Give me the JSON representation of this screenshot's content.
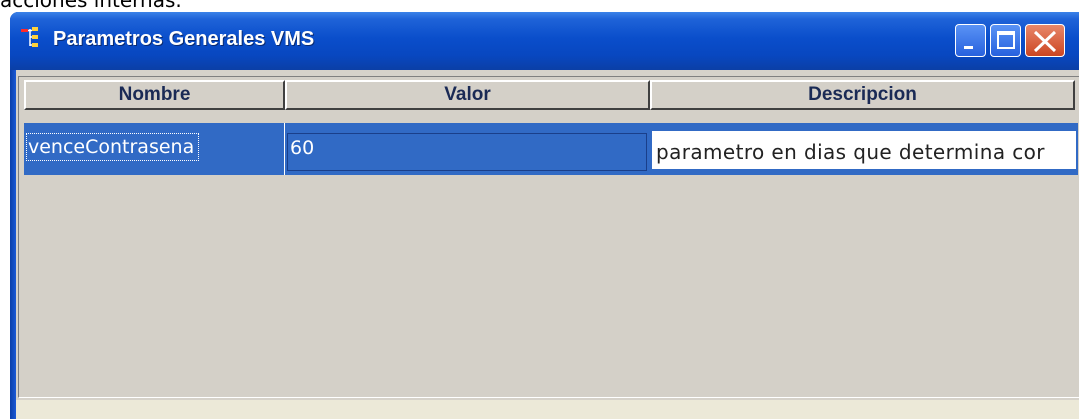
{
  "background": {
    "partial_text": "acciones internas."
  },
  "window": {
    "title": "Parametros Generales VMS",
    "icon": "tree-hierarchy-icon",
    "controls": [
      "minimize-icon",
      "maximize-icon",
      "close-icon"
    ],
    "titlebar_color": "#0a4ecb",
    "client_color": "#d4d0c8"
  },
  "table": {
    "columns": [
      "Nombre",
      "Valor",
      "Descripcion"
    ],
    "rows": [
      {
        "nombre": "venceContrasena",
        "valor": "60",
        "descripcion": "parametro en dias que determina cor"
      }
    ],
    "selection_color": "#316ac5"
  }
}
